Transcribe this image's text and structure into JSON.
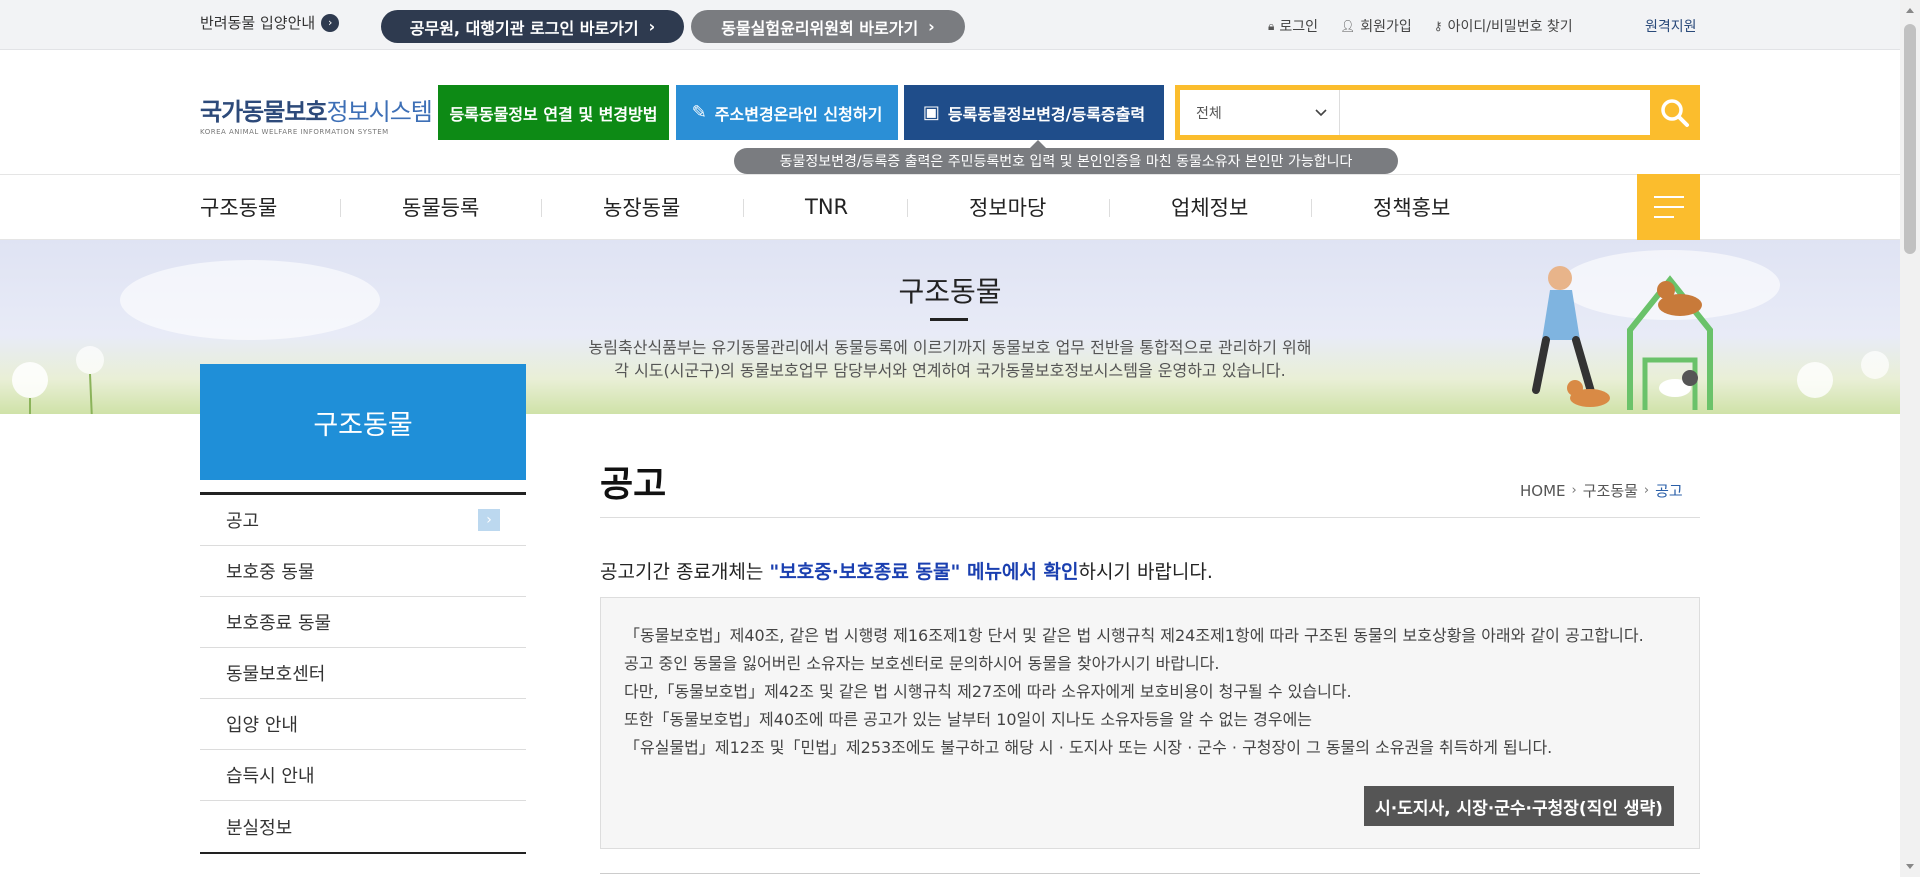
{
  "topbar": {
    "adopt_label": "반려동물 입양안내",
    "official_login": "공무원, 대행기관 로그인 바로가기",
    "ethics_committee": "동물실험윤리위원회 바로가기",
    "links": {
      "login": "로그인",
      "signup": "회원가입",
      "find": "아이디/비밀번호 찾기",
      "remote": "원격지원"
    }
  },
  "header": {
    "logo_main": "국가동물보호",
    "logo_light": "정보시스템",
    "logo_sub": "KOREA ANIMAL WELFARE INFORMATION SYSTEM",
    "btn_link": "등록동물정보 연결 및 변경방법",
    "btn_address": "주소변경온라인 신청하기",
    "btn_change": "등록동물정보변경/등록증출력",
    "tooltip": "동물정보변경/등록증 출력은 주민등록번호 입력 및 본인인증을 마친 동물소유자 본인만 가능합니다",
    "search": {
      "scope": "전체",
      "placeholder": "",
      "value": ""
    }
  },
  "nav": {
    "items": [
      "구조동물",
      "동물등록",
      "농장동물",
      "TNR",
      "정보마당",
      "업체정보",
      "정책홍보"
    ]
  },
  "banner": {
    "title": "구조동물",
    "desc1": "농림축산식품부는 유기동물관리에서 동물등록에 이르기까지 동물보호 업무 전반을 통합적으로 관리하기 위해",
    "desc2": "각 시도(시군구)의 동물보호업무 담당부서와 연계하여 국가동물보호정보시스템을 운영하고 있습니다."
  },
  "sidebar": {
    "title": "구조동물",
    "items": [
      "공고",
      "보호중 동물",
      "보호종료 동물",
      "동물보호센터",
      "입양 안내",
      "습득시 안내",
      "분실정보"
    ]
  },
  "main": {
    "title": "공고",
    "breadcrumb": [
      "HOME",
      "구조동물",
      "공고"
    ],
    "notice_pre": "공고기간 종료개체는 ",
    "notice_hl": "\"보호중·보호종료 동물\" 메뉴에서 확인",
    "notice_post": "하시기 바랍니다.",
    "lines": [
      "「동물보호법」제40조, 같은 법 시행령 제16조제1항 단서 및 같은 법 시행규칙 제24조제1항에 따라 구조된 동물의 보호상황을 아래와 같이 공고합니다.",
      "공고 중인 동물을 잃어버린 소유자는 보호센터로 문의하시어 동물을 찾아가시기 바랍니다.",
      "다만,「동물보호법」제42조 및 같은 법 시행규칙 제27조에 따라 소유자에게 보호비용이 청구될 수 있습니다.",
      "또한「동물보호법」제40조에 따른 공고가 있는 날부터 10일이 지나도 소유자등을 알 수 없는 경우에는",
      "「유실물법」제12조 및「민법」제253조에도 불구하고 해당 시 · 도지사 또는 시장 · 군수 · 구청장이 그 동물의 소유권을 취득하게 됩니다."
    ],
    "seal_button": "시·도지사, 시장·군수·구청장(직인 생략)"
  },
  "colors": {
    "accent": "#fbbd2d",
    "primary": "#1f8fd8",
    "green": "#0d8a15",
    "navy": "#1f4d8a"
  }
}
